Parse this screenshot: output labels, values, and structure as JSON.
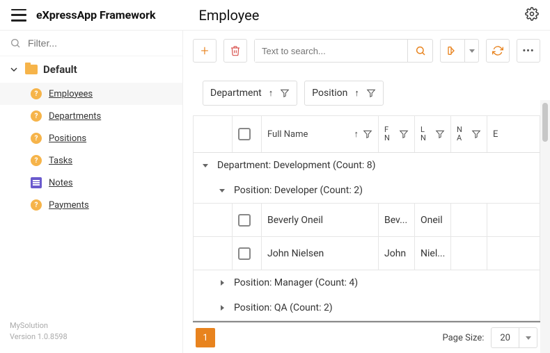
{
  "brand": "eXpressApp Framework",
  "page_title": "Employee",
  "sidebar": {
    "filter_placeholder": "Filter...",
    "folder_label": "Default",
    "items": [
      {
        "label": "Employees",
        "icon": "q",
        "selected": true
      },
      {
        "label": "Departments",
        "icon": "q",
        "selected": false
      },
      {
        "label": "Positions",
        "icon": "q",
        "selected": false
      },
      {
        "label": "Tasks",
        "icon": "q",
        "selected": false
      },
      {
        "label": "Notes",
        "icon": "notes",
        "selected": false
      },
      {
        "label": "Payments",
        "icon": "q",
        "selected": false
      }
    ],
    "footer_app": "MySolution",
    "footer_version": "Version 1.0.8598"
  },
  "toolbar": {
    "search_placeholder": "Text to search..."
  },
  "group_panel": {
    "chips": [
      {
        "label": "Department"
      },
      {
        "label": "Position"
      }
    ]
  },
  "columns": {
    "fullname": "Full Name",
    "first": "F\nN",
    "last": "L\nN",
    "extra": "N\nA",
    "extra2": "E"
  },
  "groups": {
    "dept": "Department: Development (Count: 8)",
    "pos_dev": "Position: Developer (Count: 2)",
    "pos_mgr": "Position: Manager (Count: 4)",
    "pos_qa": "Position: QA (Count: 2)"
  },
  "rows": [
    {
      "full": "Beverly Oneil",
      "first": "Bev...",
      "last": "Oneil"
    },
    {
      "full": "John Nielsen",
      "first": "John",
      "last": "Niel..."
    }
  ],
  "pager": {
    "page": "1",
    "pagesize_label": "Page Size:",
    "pagesize_value": "20"
  }
}
